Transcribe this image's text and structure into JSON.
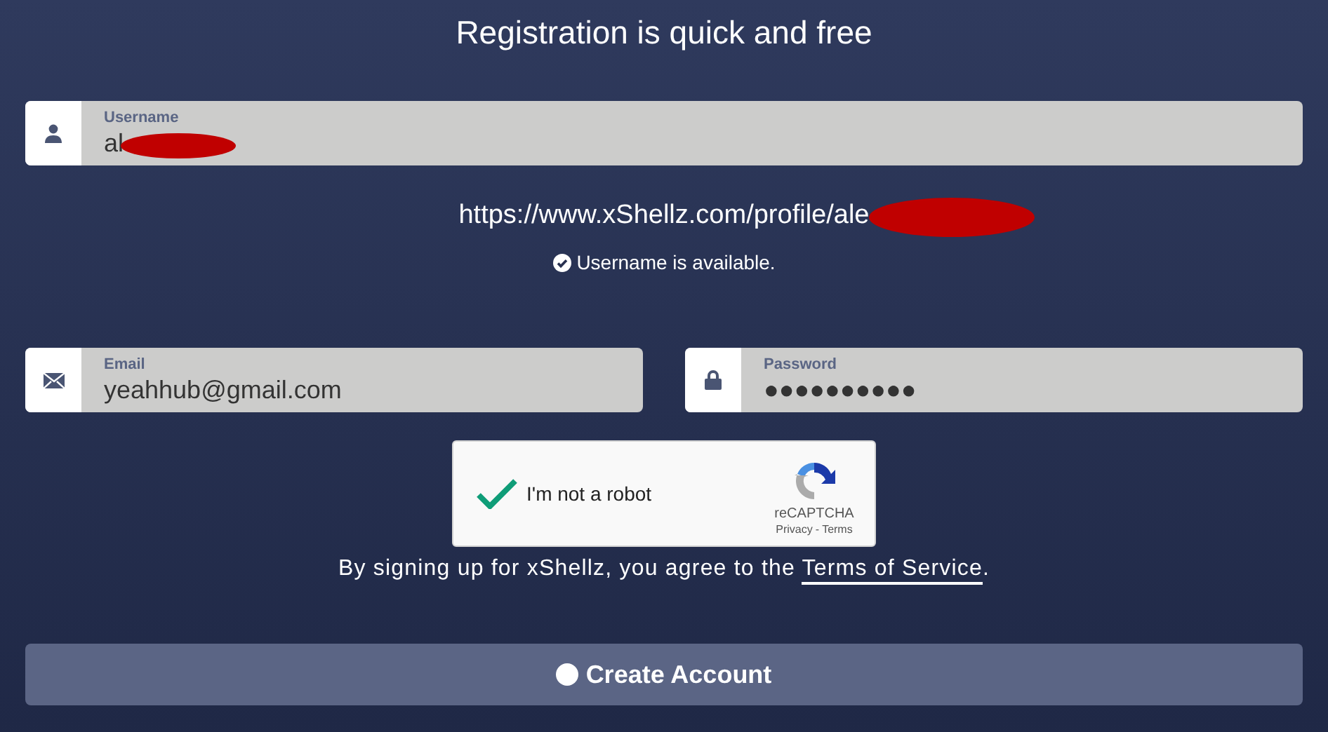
{
  "title": "Registration is quick and free",
  "username": {
    "label": "Username",
    "value": "al",
    "redacted": true
  },
  "profile_url": {
    "text": "https://www.xShellz.com/profile/ale",
    "redacted": true
  },
  "availability": {
    "text": "Username is available.",
    "available": true
  },
  "email": {
    "label": "Email",
    "value": "yeahhub@gmail.com"
  },
  "password": {
    "label": "Password",
    "value": "●●●●●●●●●●"
  },
  "captcha": {
    "label": "I'm not a robot",
    "checked": true,
    "brand": "reCAPTCHA",
    "privacy": "Privacy",
    "separator": "-",
    "terms": "Terms"
  },
  "agreement": {
    "text": "By signing up for xShellz, you agree to the ",
    "link": "Terms of Service",
    "end": "."
  },
  "submit": {
    "label": "Create Account"
  }
}
